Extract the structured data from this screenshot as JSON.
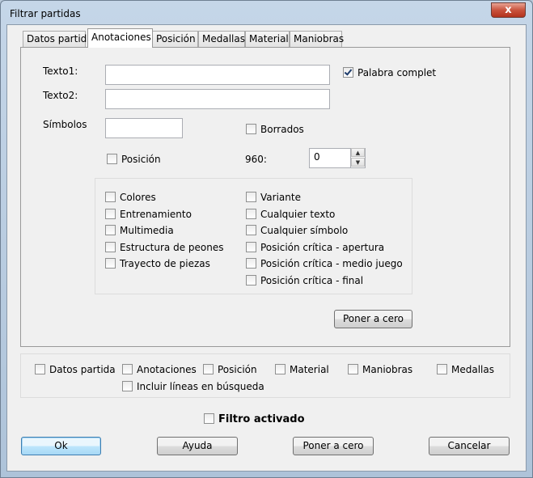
{
  "window": {
    "title": "Filtrar partidas",
    "close_glyph": "x"
  },
  "tabs": [
    {
      "label": "Datos partida"
    },
    {
      "label": "Anotaciones"
    },
    {
      "label": "Posición"
    },
    {
      "label": "Medallas"
    },
    {
      "label": "Material"
    },
    {
      "label": "Maniobras"
    }
  ],
  "anotaciones": {
    "texto1_label": "Texto1:",
    "texto1_value": "",
    "texto2_label": "Texto2:",
    "texto2_value": "",
    "palabra_completa": {
      "label": "Palabra complet",
      "checked": true
    },
    "simbolos_label": "Símbolos",
    "simbolos_value": "",
    "borrados": {
      "label": "Borrados",
      "checked": false
    },
    "posicion": {
      "label": "Posición",
      "checked": false
    },
    "n960_label": "960:",
    "n960_value": "0",
    "left_checks": [
      "Colores",
      "Entrenamiento",
      "Multimedia",
      "Estructura de peones",
      "Trayecto de piezas"
    ],
    "right_checks": [
      "Variante",
      "Cualquier texto",
      "Cualquier símbolo",
      "Posición crítica - apertura",
      "Posición crítica - medio juego",
      "Posición crítica - final"
    ],
    "reset_label": "Poner a cero"
  },
  "bottom_checks": [
    "Datos partida",
    "Anotaciones",
    "Posición",
    "Material",
    "Maniobras",
    "Medallas"
  ],
  "include_lines": "Incluir líneas en búsqueda",
  "filtro_activado": "Filtro activado",
  "buttons": {
    "ok": "Ok",
    "ayuda": "Ayuda",
    "poner_a_cero": "Poner a cero",
    "cancelar": "Cancelar"
  }
}
